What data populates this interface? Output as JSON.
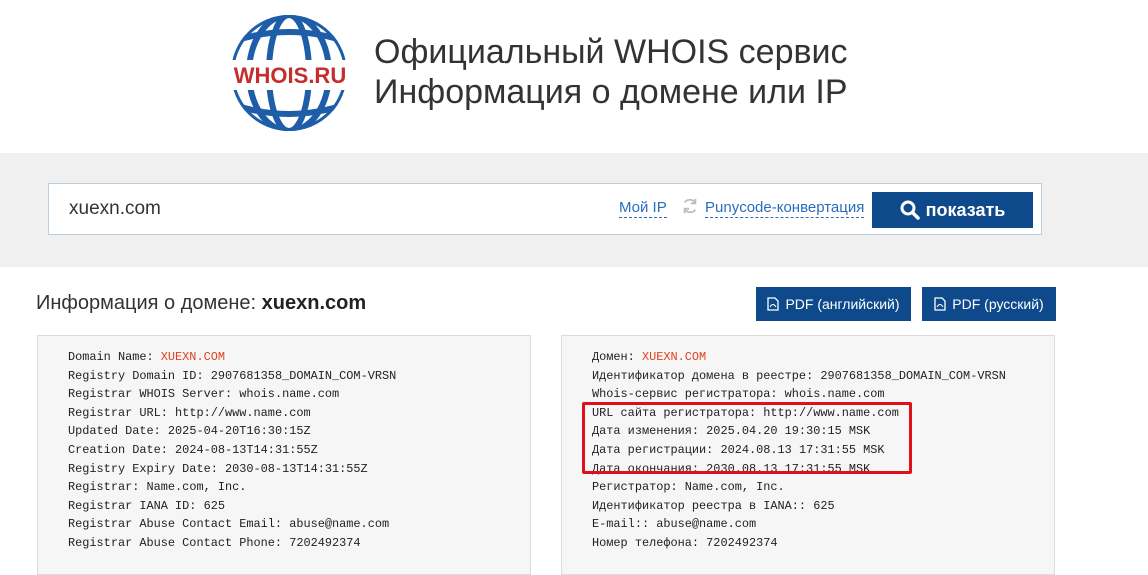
{
  "header": {
    "logo_text": "WHOIS.RU",
    "tagline_line1": "Официальный WHOIS сервис",
    "tagline_line2": "Информация о домене или IP"
  },
  "search": {
    "value": "xuexn.com",
    "my_ip_label": "Мой IP",
    "punycode_label": "Punycode-конвертация",
    "submit_label": "показать"
  },
  "info": {
    "title_prefix": "Информация о домене:",
    "domain": "xuexn.com",
    "pdf_en_label": "PDF (английский)",
    "pdf_ru_label": "PDF (русский)"
  },
  "whois_en": [
    {
      "key": "Domain Name: ",
      "value": "XUEXN.COM",
      "highlight": true
    },
    {
      "key": "Registry Domain ID: ",
      "value": "2907681358_DOMAIN_COM-VRSN"
    },
    {
      "key": "Registrar WHOIS Server: ",
      "value": "whois.name.com"
    },
    {
      "key": "Registrar URL: ",
      "value": "http://www.name.com"
    },
    {
      "key": "Updated Date: ",
      "value": "2025-04-20T16:30:15Z"
    },
    {
      "key": "Creation Date: ",
      "value": "2024-08-13T14:31:55Z"
    },
    {
      "key": "Registry Expiry Date: ",
      "value": "2030-08-13T14:31:55Z"
    },
    {
      "key": "Registrar: ",
      "value": "Name.com, Inc."
    },
    {
      "key": "Registrar IANA ID: ",
      "value": "625"
    },
    {
      "key": "Registrar Abuse Contact Email: ",
      "value": "abuse@name.com"
    },
    {
      "key": "Registrar Abuse Contact Phone: ",
      "value": "7202492374"
    }
  ],
  "whois_ru": [
    {
      "key": "Домен: ",
      "value": "XUEXN.COM",
      "highlight": true
    },
    {
      "key": "Идентификатор домена в реестре: ",
      "value": "2907681358_DOMAIN_COM-VRSN"
    },
    {
      "key": "Whois-сервис регистратора: ",
      "value": "whois.name.com"
    },
    {
      "key": "URL сайта регистратора: ",
      "value": "http://www.name.com"
    },
    {
      "key": "Дата изменения: ",
      "value": "2025.04.20 19:30:15 MSK"
    },
    {
      "key": "Дата регистрации: ",
      "value": "2024.08.13 17:31:55 MSK"
    },
    {
      "key": "Дата окончания: ",
      "value": "2030.08.13 17:31:55 MSK"
    },
    {
      "key": "Регистратор: ",
      "value": "Name.com, Inc."
    },
    {
      "key": "Идентификатор реестра в IANA:: ",
      "value": "625"
    },
    {
      "key": "E-mail:: ",
      "value": "abuse@name.com"
    },
    {
      "key": "Номер телефона: ",
      "value": "7202492374"
    }
  ],
  "colors": {
    "brand_blue": "#0e4a8b",
    "link_blue": "#2a6ebb",
    "highlight_red": "#e0101b",
    "domain_orange": "#e2401c"
  }
}
